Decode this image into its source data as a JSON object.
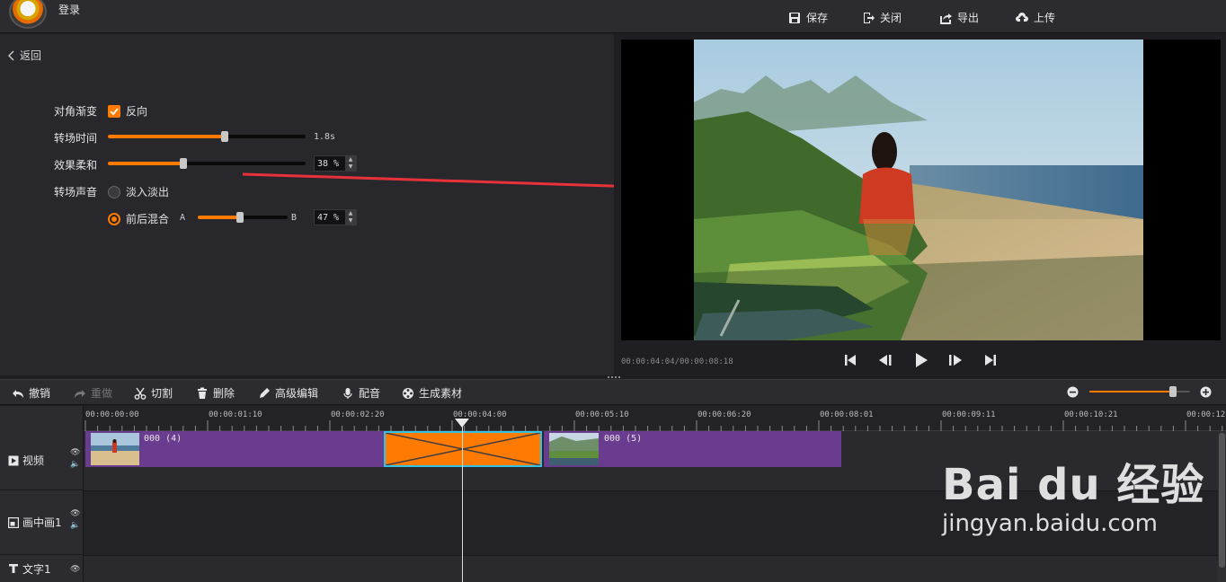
{
  "topbar": {
    "login": "登录",
    "buttons": [
      {
        "label": "保存",
        "icon": "save-icon"
      },
      {
        "label": "关闭",
        "icon": "exit-icon"
      },
      {
        "label": "导出",
        "icon": "export-icon"
      },
      {
        "label": "上传",
        "icon": "upload-icon"
      }
    ]
  },
  "panel": {
    "back": "返回",
    "diagonal_label": "对角渐变",
    "reverse_label": "反向",
    "reverse_checked": true,
    "duration_label": "转场时间",
    "duration_value": "1.8s",
    "duration_fraction": 0.59,
    "softness_label": "效果柔和",
    "softness_value": "38 %",
    "softness_fraction": 0.38,
    "sound_label": "转场声音",
    "sound_options": [
      "淡入淡出",
      "前后混合"
    ],
    "sound_selected": "前后混合",
    "mix_a": "A",
    "mix_b": "B",
    "mix_value": "47 %",
    "mix_fraction": 0.47
  },
  "preview": {
    "timecode": "00:00:04:04/00:00:08:18",
    "controls": [
      "skip-start-icon",
      "step-back-icon",
      "play-icon",
      "step-forward-icon",
      "skip-end-icon"
    ]
  },
  "edit_toolbar": {
    "buttons": [
      {
        "label": "撤销",
        "icon": "undo-icon",
        "enabled": true
      },
      {
        "label": "重做",
        "icon": "redo-icon",
        "enabled": false
      },
      {
        "label": "切割",
        "icon": "scissors-icon",
        "enabled": true
      },
      {
        "label": "删除",
        "icon": "trash-icon",
        "enabled": true
      },
      {
        "label": "高级编辑",
        "icon": "pen-icon",
        "enabled": true
      },
      {
        "label": "配音",
        "icon": "mic-icon",
        "enabled": true
      },
      {
        "label": "生成素材",
        "icon": "film-reel-icon",
        "enabled": true
      }
    ],
    "zoom_fraction": 0.83
  },
  "timeline": {
    "ruler": [
      "00:00:00:00",
      "00:00:01:10",
      "00:00:02:20",
      "00:00:04:00",
      "00:00:05:10",
      "00:00:06:20",
      "00:00:08:01",
      "00:00:09:11",
      "00:00:10:21",
      "00:00:12:"
    ],
    "tracks": [
      {
        "name": "视频",
        "icon": "play-box-icon"
      },
      {
        "name": "画中画1",
        "icon": "pip-icon"
      },
      {
        "name": "文字1",
        "icon": "text-icon"
      }
    ],
    "clips": [
      {
        "label": "000 (4)"
      },
      {
        "label": "000 (5)"
      }
    ]
  },
  "watermark": {
    "main": "Bai du 经验",
    "sub": "jingyan.baidu.com"
  },
  "colors": {
    "accent": "#ff7a00",
    "clip": "#6a3c8f",
    "transition_outline": "#33c3e6"
  }
}
